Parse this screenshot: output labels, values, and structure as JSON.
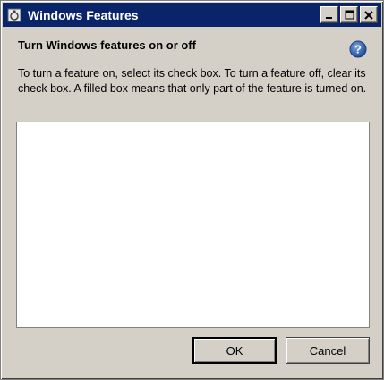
{
  "window": {
    "title": "Windows Features",
    "title_icon": "windows-features-icon",
    "controls": {
      "minimize": "minimize-icon",
      "maximize": "maximize-icon",
      "close": "close-icon"
    }
  },
  "content": {
    "heading": "Turn Windows features on or off",
    "help_icon": "help-icon",
    "description": "To turn a feature on, select its check box. To turn a feature off, clear its check box. A filled box means that only part of the feature is turned on."
  },
  "features_list": {
    "items": []
  },
  "buttons": {
    "ok_label": "OK",
    "cancel_label": "Cancel"
  },
  "colors": {
    "titlebar": "#0a246a",
    "window_bg": "#d4d0c8",
    "help_blue": "#2f5fa8"
  }
}
